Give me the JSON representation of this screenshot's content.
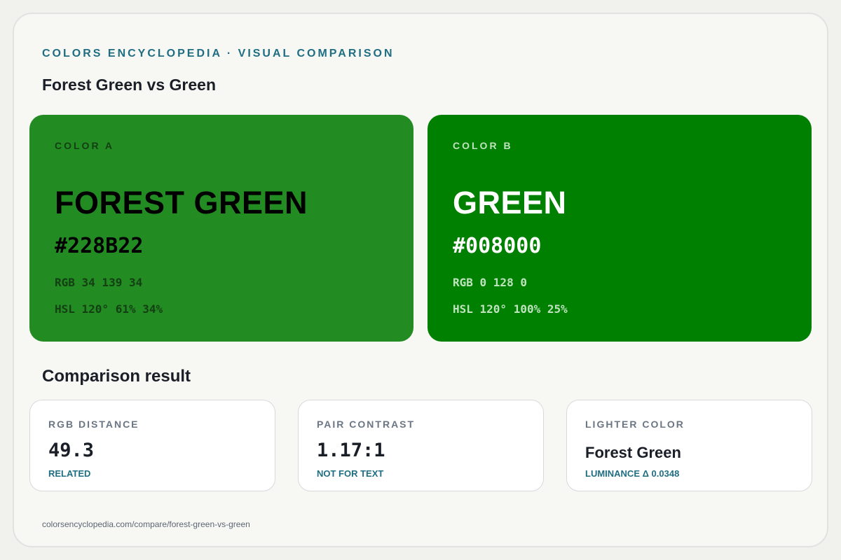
{
  "header": {
    "eyebrow": "COLORS ENCYCLOPEDIA · VISUAL COMPARISON",
    "title": "Forest Green vs Green"
  },
  "colors": {
    "a": {
      "slot": "COLOR A",
      "name": "FOREST GREEN",
      "hex": "#228B22",
      "rgb": "RGB 34 139 34",
      "hsl": "HSL 120° 61% 34%",
      "background": "#228B22",
      "text_color": "#000000",
      "muted_color": "#143f14"
    },
    "b": {
      "slot": "COLOR B",
      "name": "GREEN",
      "hex": "#008000",
      "rgb": "RGB 0 128 0",
      "hsl": "HSL 120° 100% 25%",
      "background": "#008000",
      "text_color": "#ffffff",
      "muted_color": "#bfe3bf"
    }
  },
  "comparison": {
    "title": "Comparison result",
    "cards": [
      {
        "label": "RGB DISTANCE",
        "value": "49.3",
        "note": "RELATED"
      },
      {
        "label": "PAIR CONTRAST",
        "value": "1.17:1",
        "note": "NOT FOR TEXT"
      },
      {
        "label": "LIGHTER COLOR",
        "value": "Forest Green",
        "note": "LUMINANCE Δ 0.0348"
      }
    ]
  },
  "footer": {
    "url": "colorsencyclopedia.com/compare/forest-green-vs-green"
  },
  "theme": {
    "accent": "#1f6e82",
    "heading": "#1a1e27",
    "muted": "#6b7684"
  }
}
